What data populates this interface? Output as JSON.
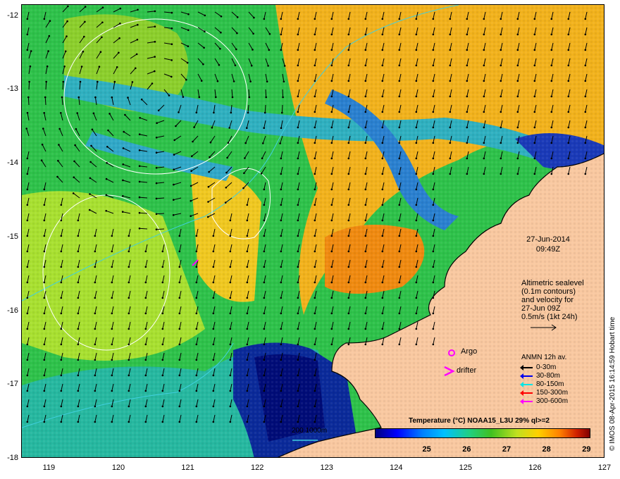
{
  "map": {
    "date": "27-Jun-2014",
    "time": "09:49Z",
    "lat_ticks": [
      "-12",
      "-13",
      "-14",
      "-15",
      "-16",
      "-17",
      "-18"
    ],
    "lon_ticks": [
      "119",
      "120",
      "121",
      "122",
      "123",
      "124",
      "125",
      "126",
      "127"
    ],
    "lat_range": [
      -18,
      -11.85
    ],
    "lon_range": [
      118.6,
      127.0
    ]
  },
  "info_block": {
    "line1": "Altimetric sealevel",
    "line2": "(0.1m contours)",
    "line3": "and velocity for",
    "line4": "27-Jun 09Z",
    "line5": "0.5m/s (1kt 24h)"
  },
  "markers": {
    "argo": "Argo",
    "drifter": "drifter"
  },
  "anmn_legend": {
    "title": "ANMN 12h av.",
    "rows": [
      {
        "label": "0-30m",
        "color": "#000000"
      },
      {
        "label": "30-80m",
        "color": "#0000ee"
      },
      {
        "label": "80-150m",
        "color": "#00e5e5"
      },
      {
        "label": "150-300m",
        "color": "#ff0000"
      },
      {
        "label": "300-600m",
        "color": "#ff00ff"
      }
    ]
  },
  "isobath_label": "200  1000m",
  "colorbar": {
    "title": "Temperature (°C) NOAA15_L3U 29% ql>=2",
    "ticks": [
      "25",
      "26",
      "27",
      "28",
      "29"
    ],
    "range": [
      23.7,
      29.1
    ]
  },
  "credit": "© IMOS 08-Apr-2015 16:14:59 Hobart time",
  "colors": {
    "land": "#f9c8a0",
    "ocean_low": "#000080",
    "ocean_high": "#800000",
    "isobath": "#40d0e0",
    "sealevel_contour": "#ffffff"
  }
}
